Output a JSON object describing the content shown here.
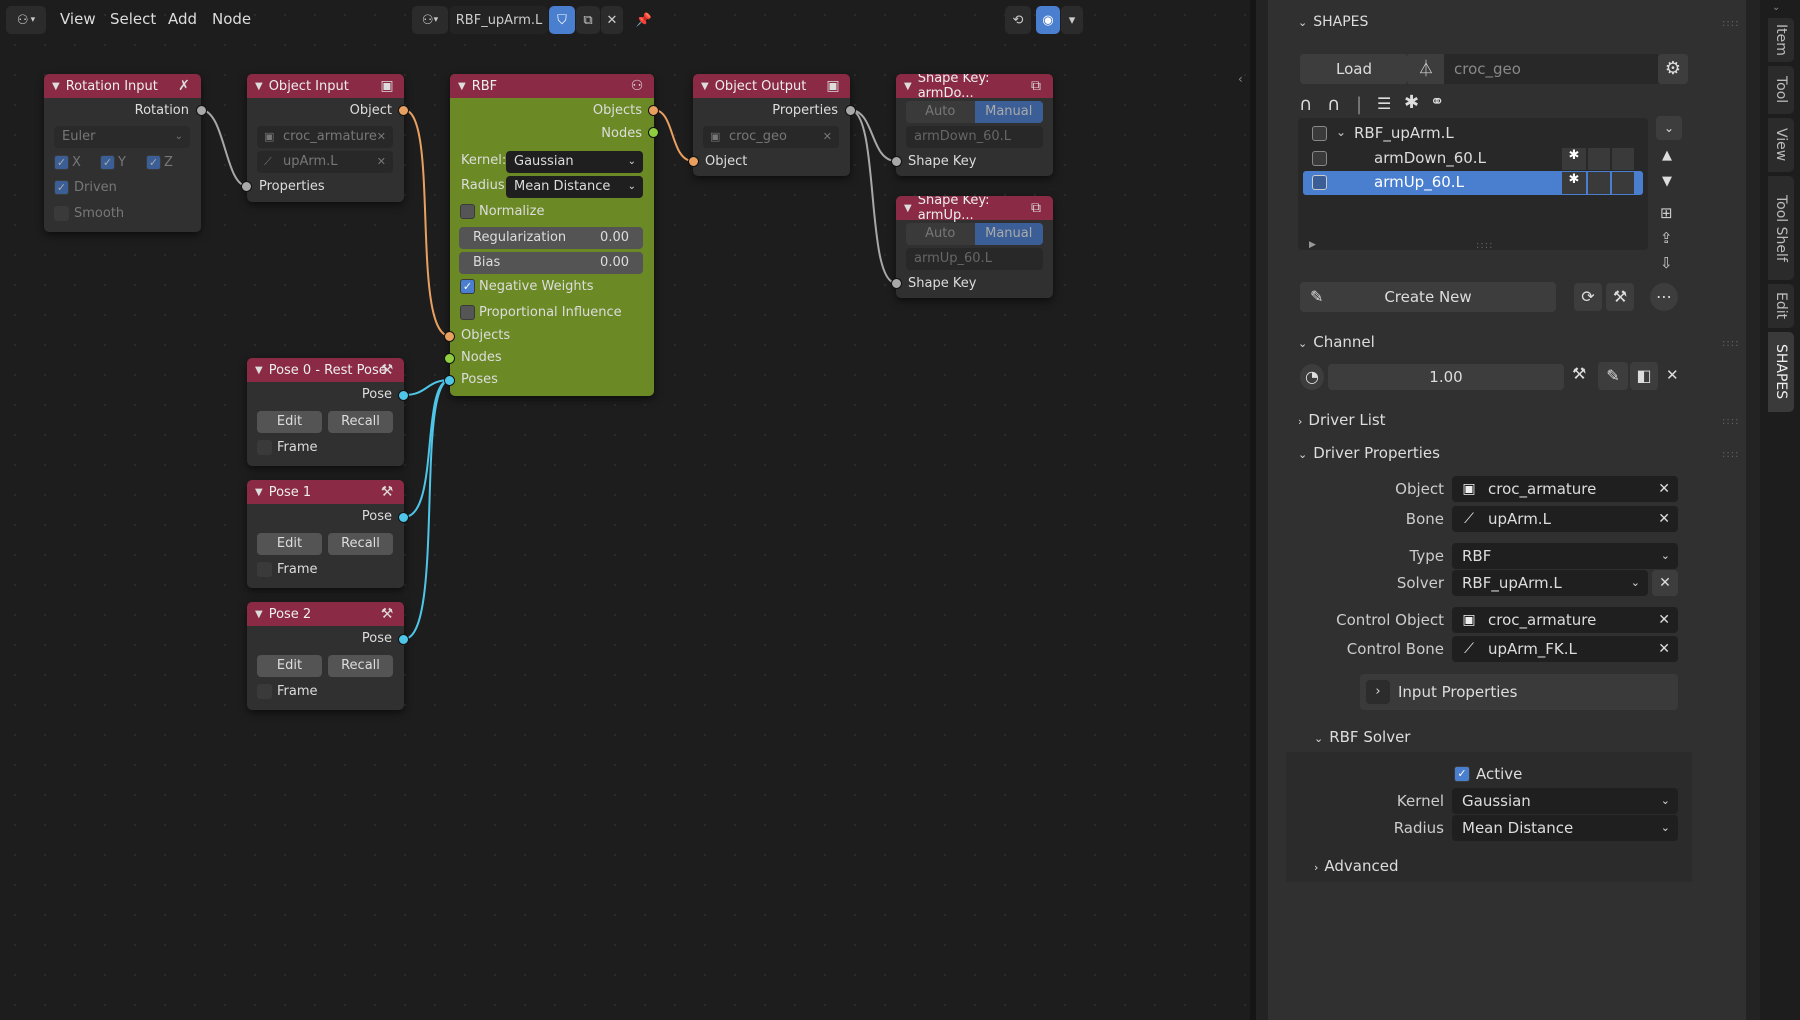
{
  "menu": {
    "view": "View",
    "select": "Select",
    "add": "Add",
    "node": "Node"
  },
  "tree": {
    "name": "RBF_upArm.L"
  },
  "nodes": {
    "rotation_input": {
      "title": "Rotation Input",
      "out_rotation": "Rotation",
      "mode": "Euler",
      "x": "X",
      "y": "Y",
      "z": "Z",
      "driven": "Driven",
      "smooth": "Smooth"
    },
    "object_input": {
      "title": "Object Input",
      "out_object": "Object",
      "armature": "croc_armature",
      "bone": "upArm.L",
      "in_properties": "Properties"
    },
    "rbf": {
      "title": "RBF",
      "out_objects": "Objects",
      "out_nodes": "Nodes",
      "kernel_label": "Kernel:",
      "kernel": "Gaussian",
      "radius_label": "Radius:",
      "radius": "Mean Distance",
      "normalize": "Normalize",
      "regularization": "Regularization",
      "regularization_value": "0.00",
      "bias": "Bias",
      "bias_value": "0.00",
      "negative_weights": "Negative Weights",
      "proportional_influence": "Proportional Influence",
      "in_objects": "Objects",
      "in_nodes": "Nodes",
      "in_poses": "Poses"
    },
    "object_output": {
      "title": "Object Output",
      "out_properties": "Properties",
      "geo": "croc_geo",
      "in_object": "Object"
    },
    "shape_key_down": {
      "title": "Shape Key: armDo...",
      "auto": "Auto",
      "manual": "Manual",
      "key": "armDown_60.L",
      "in_shape_key": "Shape Key"
    },
    "shape_key_up": {
      "title": "Shape Key: armUp...",
      "auto": "Auto",
      "manual": "Manual",
      "key": "armUp_60.L",
      "in_shape_key": "Shape Key"
    },
    "pose0": {
      "title": "Pose 0 - Rest Pose",
      "out_pose": "Pose",
      "edit": "Edit",
      "recall": "Recall",
      "frame": "Frame"
    },
    "pose1": {
      "title": "Pose 1",
      "out_pose": "Pose",
      "edit": "Edit",
      "recall": "Recall",
      "frame": "Frame"
    },
    "pose2": {
      "title": "Pose 2",
      "out_pose": "Pose",
      "edit": "Edit",
      "recall": "Recall",
      "frame": "Frame"
    }
  },
  "panel": {
    "shapes_header": "SHAPES",
    "load": "Load",
    "mesh": "croc_geo",
    "list": [
      {
        "label": "RBF_upArm.L"
      },
      {
        "label": "armDown_60.L"
      },
      {
        "label": "armUp_60.L"
      }
    ],
    "create_new": "Create New",
    "channel_header": "Channel",
    "channel_value": "1.00",
    "driver_list": "Driver List",
    "driver_properties": "Driver Properties",
    "object_label": "Object",
    "object_value": "croc_armature",
    "bone_label": "Bone",
    "bone_value": "upArm.L",
    "type_label": "Type",
    "type_value": "RBF",
    "solver_label": "Solver",
    "solver_value": "RBF_upArm.L",
    "control_object_label": "Control Object",
    "control_object_value": "croc_armature",
    "control_bone_label": "Control Bone",
    "control_bone_value": "upArm_FK.L",
    "input_properties": "Input Properties",
    "rbf_solver": "RBF Solver",
    "active": "Active",
    "kernel_label": "Kernel",
    "kernel_value": "Gaussian",
    "radius_label": "Radius",
    "radius_value": "Mean Distance",
    "advanced": "Advanced"
  },
  "tabs": [
    "Item",
    "Tool",
    "View",
    "Tool Shelf",
    "Edit",
    "SHAPES"
  ],
  "colors": {
    "node_header": "#8a2a45",
    "rbf_body": "#6b8a25",
    "accent": "#4a7fd0",
    "socket_orange": "#e8a060",
    "socket_green": "#8fcf3f",
    "socket_cyan": "#4fc5e8"
  }
}
